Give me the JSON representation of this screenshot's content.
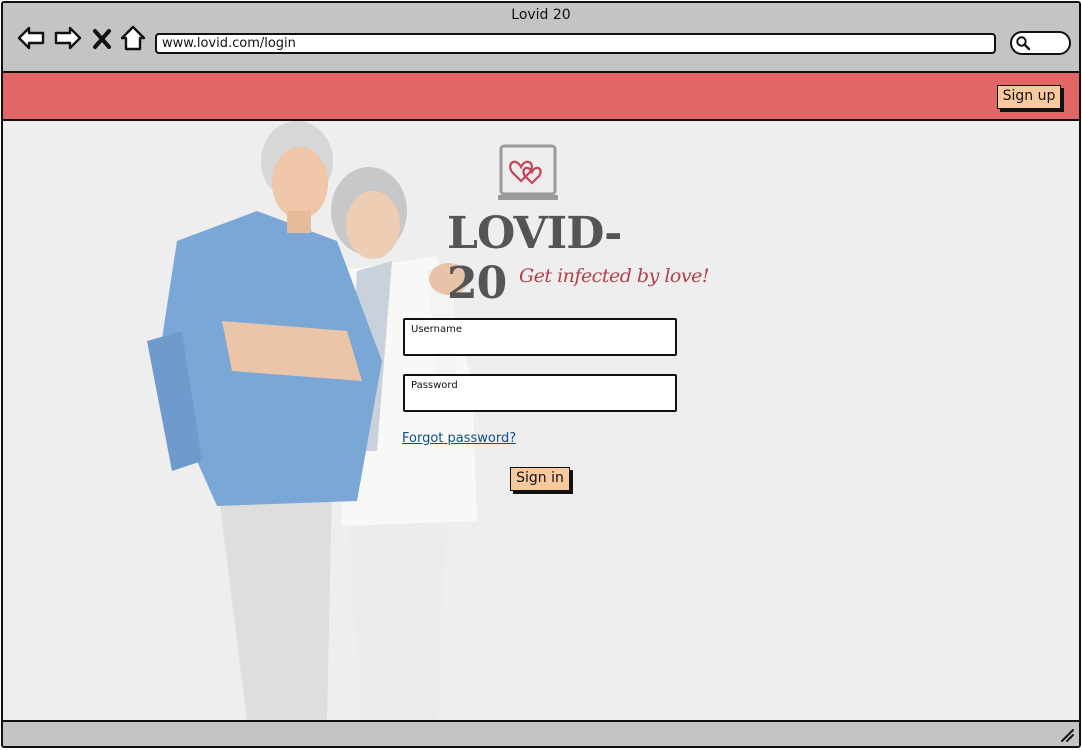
{
  "browser": {
    "title": "Lovid 20",
    "url": "www.lovid.com/login",
    "nav_icons": [
      "back-arrow-icon",
      "forward-arrow-icon",
      "close-x-icon",
      "home-icon"
    ],
    "search_icon": "search-icon"
  },
  "header": {
    "bar_color": "#e16666",
    "signup_label": "Sign up"
  },
  "logo": {
    "icon": "heart-monitor-icon",
    "wordmark": "LOVID-20",
    "tagline": "Get infected by love!"
  },
  "login_form": {
    "username_label": "Username",
    "username_value": "",
    "password_label": "Password",
    "password_value": "",
    "forgot_link": "Forgot password?",
    "signin_label": "Sign in"
  },
  "colors": {
    "button_fill": "#f8c99e",
    "link": "#0a4f8f",
    "tagline": "#b2404b",
    "page_bg": "#eeeeee"
  }
}
